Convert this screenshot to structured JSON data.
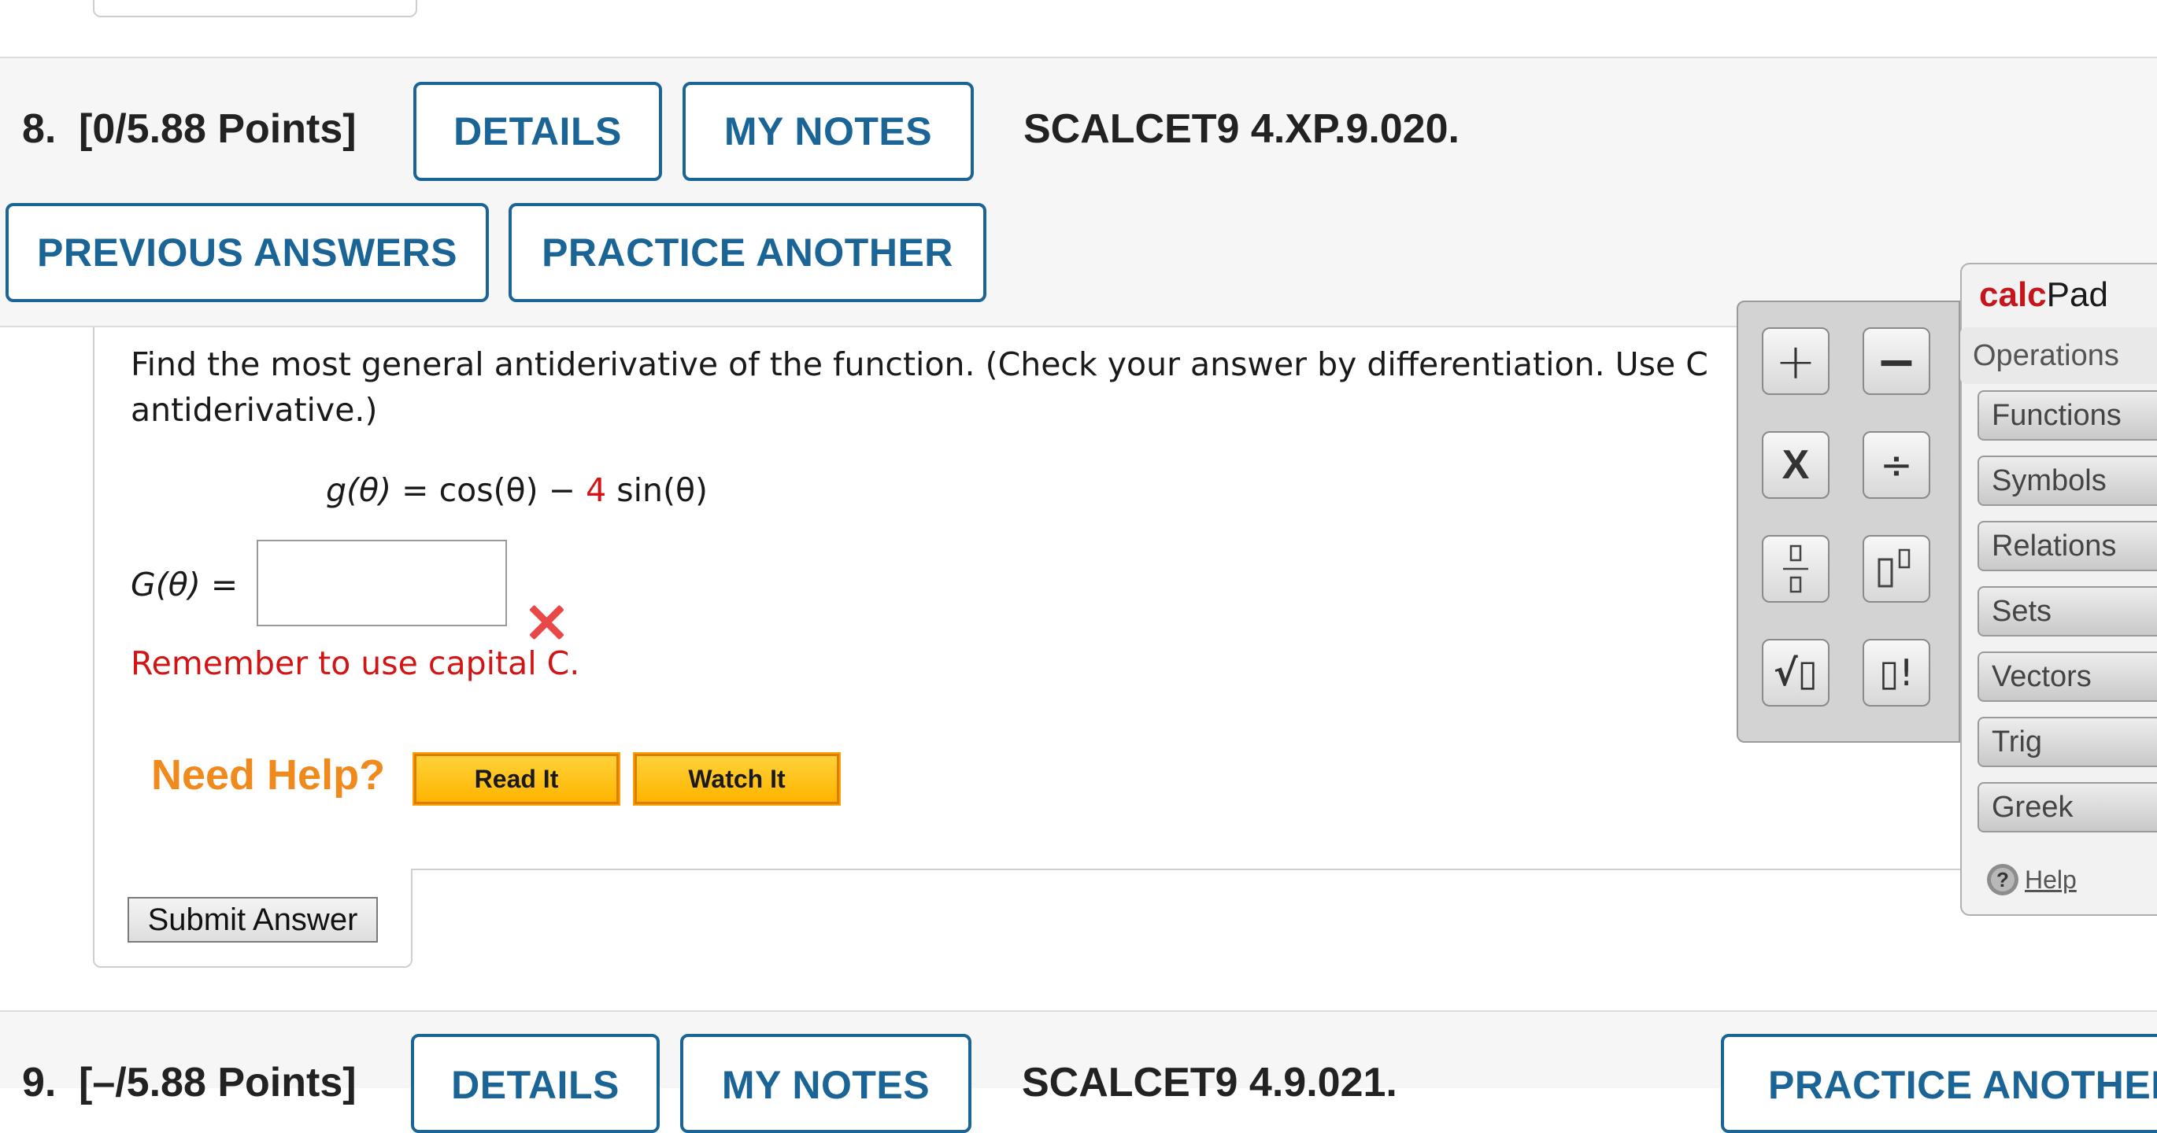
{
  "q8": {
    "number_label": "8.",
    "points_label": "[0/5.88 Points]",
    "details_label": "DETAILS",
    "my_notes_label": "MY NOTES",
    "code": "SCALCET9 4.XP.9.020.",
    "previous_answers_label": "PREVIOUS ANSWERS",
    "practice_another_label": "PRACTICE ANOTHER",
    "prompt_line1": "Find the most general antiderivative of the function. (Check your answer by differentiation. Use C",
    "prompt_line2": "antiderivative.)",
    "function": {
      "lhs": "g(θ)",
      "eq": "=",
      "t1": "cos(θ)",
      "minus": "−",
      "coef": "4",
      "t2": "sin(θ)"
    },
    "answer_label": "G(θ) =",
    "answer_value": "",
    "error_message": "Remember to use capital C.",
    "need_help_label": "Need Help?",
    "read_it_label": "Read It",
    "watch_it_label": "Watch It",
    "submit_label": "Submit Answer"
  },
  "q9": {
    "number_label": "9.",
    "points_label": "[–/5.88 Points]",
    "details_label": "DETAILS",
    "my_notes_label": "MY NOTES",
    "code": "SCALCET9 4.9.021.",
    "practice_another_label": "PRACTICE ANOTHER"
  },
  "calcpad": {
    "title_bold": "calc",
    "title_rest": "Pad",
    "tabs": [
      "Operations",
      "Functions",
      "Symbols",
      "Relations",
      "Sets",
      "Vectors",
      "Trig",
      "Greek"
    ],
    "active_tab": "Operations",
    "help_label": "Help",
    "buttons": {
      "plus": "+",
      "minus": "−",
      "times": "X",
      "divide": "÷",
      "sqrt": "√▯",
      "factorial": "▯!"
    }
  },
  "colors": {
    "accent_blue": "#1a6496",
    "error_red": "#d21414",
    "help_orange": "#f08a1c",
    "calc_red": "#c4161c"
  }
}
